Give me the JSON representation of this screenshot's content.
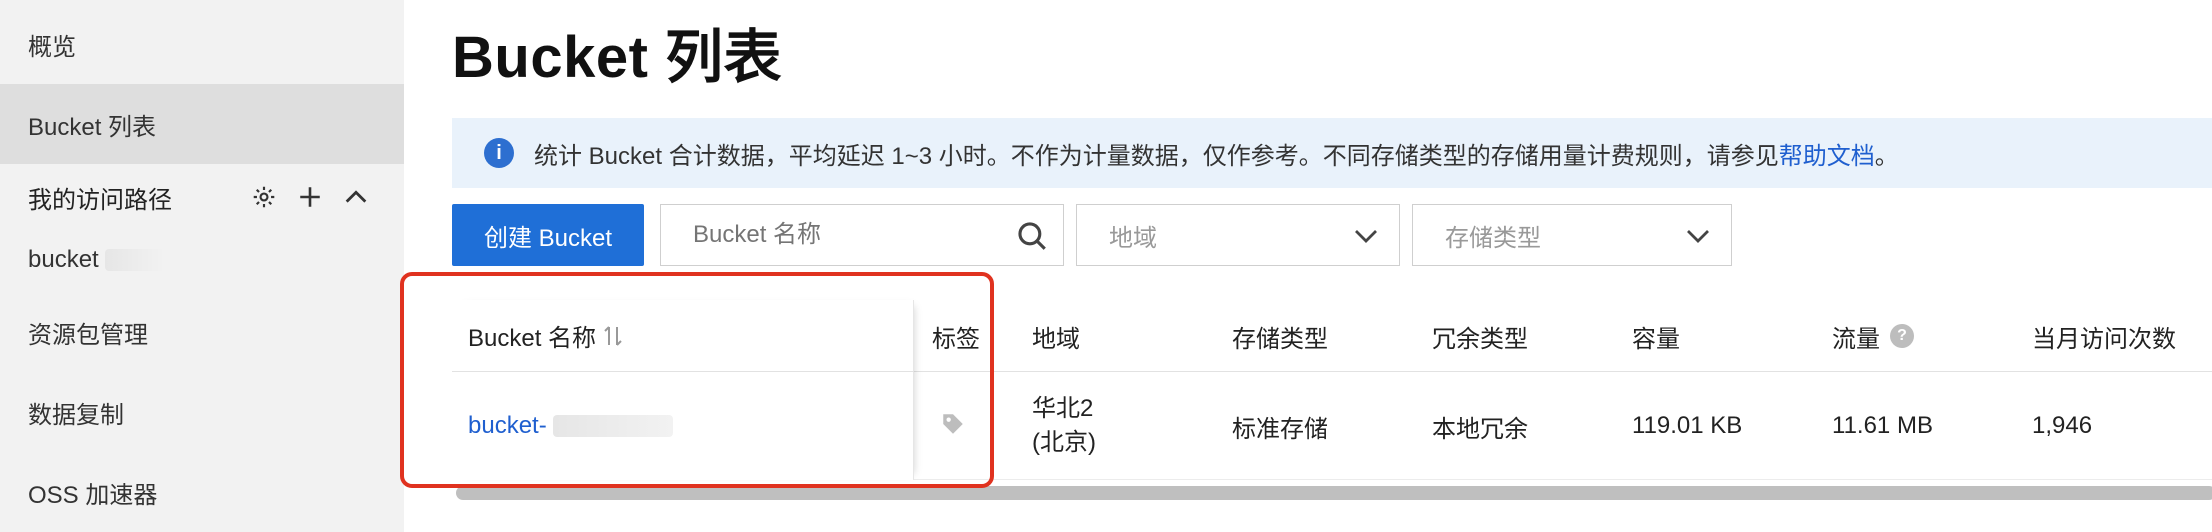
{
  "sidebar": {
    "items": [
      {
        "label": "概览",
        "active": false
      },
      {
        "label": "Bucket 列表",
        "active": true
      }
    ],
    "access_paths": {
      "title": "我的访问路径",
      "items": [
        "bucket"
      ]
    },
    "bottom_items": [
      {
        "label": "资源包管理"
      },
      {
        "label": "数据复制"
      },
      {
        "label": "OSS 加速器"
      }
    ]
  },
  "page": {
    "title": "Bucket 列表",
    "banner": {
      "text": "统计 Bucket 合计数据，平均延迟 1~3 小时。不作为计量数据，仅作参考。不同存储类型的存储用量计费规则，请参见",
      "link_text": "帮助文档",
      "suffix": "。"
    },
    "toolbar": {
      "create_label": "创建 Bucket",
      "search_placeholder": "Bucket 名称",
      "region_placeholder": "地域",
      "storage_class_placeholder": "存储类型"
    },
    "table": {
      "headers": {
        "name": "Bucket 名称",
        "tags": "标签",
        "region": "地域",
        "storage_class": "存储类型",
        "redundancy": "冗余类型",
        "capacity": "容量",
        "traffic": "流量",
        "visits": "当月访问次数"
      },
      "rows": [
        {
          "name": "bucket-",
          "region_line1": "华北2",
          "region_line2": "(北京)",
          "storage_class": "标准存储",
          "redundancy": "本地冗余",
          "capacity": "119.01 KB",
          "traffic": "11.61 MB",
          "visits": "1,946"
        }
      ]
    }
  },
  "colors": {
    "primary": "#1f6fd7",
    "link": "#1f5fcf",
    "banner_bg": "#e9f2fb",
    "highlight": "#e0321f"
  }
}
